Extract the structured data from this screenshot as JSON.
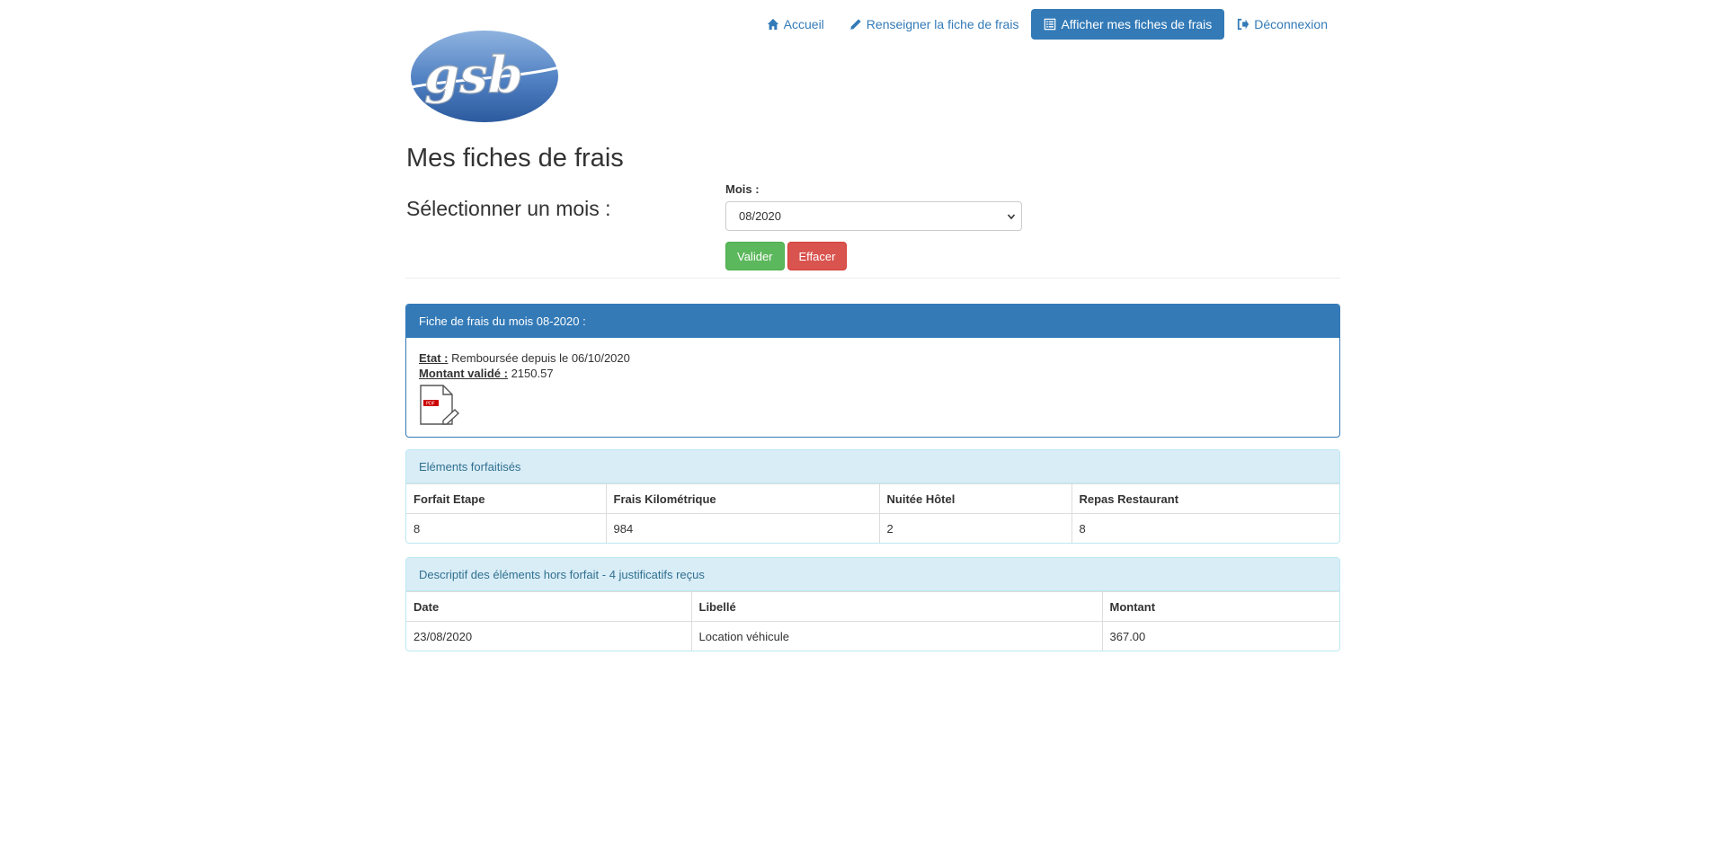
{
  "nav": {
    "home": "Accueil",
    "fill": "Renseigner la fiche de frais",
    "view": "Afficher mes fiches de frais",
    "logout": "Déconnexion"
  },
  "logo_text": "gsb",
  "page_title": "Mes fiches de frais",
  "select_heading": "Sélectionner un mois :",
  "form": {
    "month_label": "Mois :",
    "month_value": "08/2020",
    "validate": "Valider",
    "clear": "Effacer"
  },
  "sheet": {
    "header": "Fiche de frais du mois 08-2020 :",
    "state_label": "Etat :",
    "state_value": "Remboursée depuis le 06/10/2020",
    "amount_label": "Montant validé :",
    "amount_value": "2150.57",
    "pdf_badge": "PDF"
  },
  "flat": {
    "header": "Eléments forfaitisés",
    "columns": [
      "Forfait Etape",
      "Frais Kilométrique",
      "Nuitée Hôtel",
      "Repas Restaurant"
    ],
    "values": [
      "8",
      "984",
      "2",
      "8"
    ]
  },
  "offflat": {
    "header": "Descriptif des éléments hors forfait - 4 justificatifs reçus",
    "columns": [
      "Date",
      "Libellé",
      "Montant"
    ],
    "rows": [
      [
        "23/08/2020",
        "Location véhicule",
        "367.00"
      ]
    ]
  },
  "colors": {
    "primary": "#337ab7",
    "success": "#5cb85c",
    "danger": "#d9534f",
    "info_bg": "#d9edf7"
  }
}
